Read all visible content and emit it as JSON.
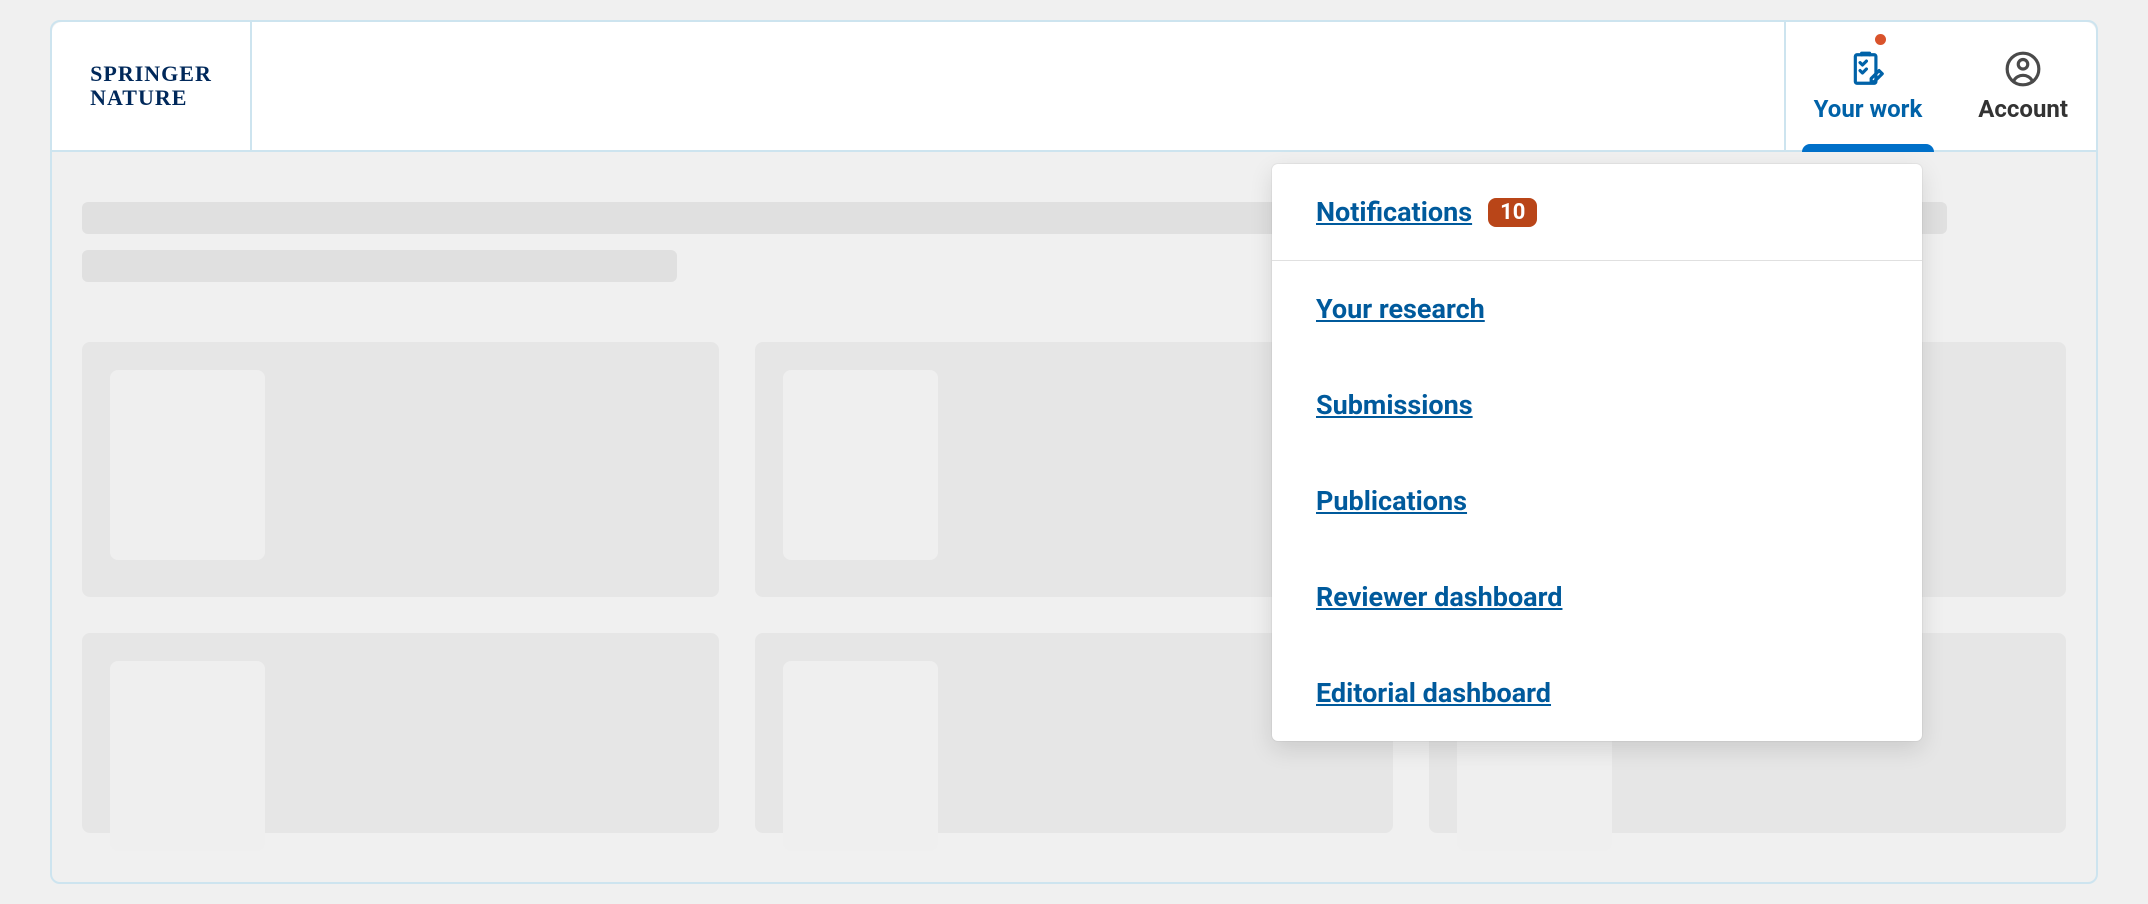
{
  "brand": {
    "line1": "SPRINGER",
    "line2": "NATURE"
  },
  "header": {
    "your_work": {
      "label": "Your work",
      "active": true
    },
    "account": {
      "label": "Account"
    }
  },
  "dropdown": {
    "notifications": {
      "label": "Notifications",
      "badge": "10"
    },
    "items": [
      {
        "label": "Your research"
      },
      {
        "label": "Submissions"
      },
      {
        "label": "Publications"
      },
      {
        "label": "Reviewer dashboard"
      },
      {
        "label": "Editorial dashboard"
      }
    ]
  },
  "colors": {
    "brand_dark_blue": "#00285a",
    "link_blue": "#005a9c",
    "accent_blue": "#0070c9",
    "badge_bg": "#b94518"
  }
}
